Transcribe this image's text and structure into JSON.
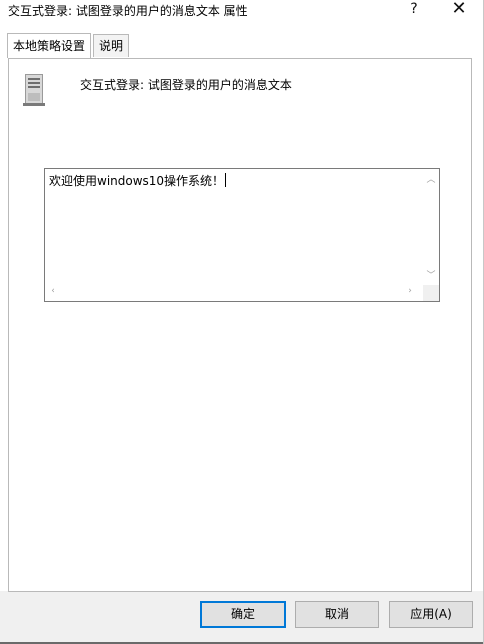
{
  "window": {
    "title": "交互式登录: 试图登录的用户的消息文本 属性",
    "help_glyph": "?",
    "close_glyph": "✕"
  },
  "tabs": [
    {
      "label": "本地策略设置",
      "active": true
    },
    {
      "label": "说明",
      "active": false
    }
  ],
  "setting": {
    "icon": "server-icon",
    "label": "交互式登录: 试图登录的用户的消息文本"
  },
  "message_box": {
    "value": "欢迎使用windows10操作系统！"
  },
  "buttons": {
    "ok": "确定",
    "cancel": "取消",
    "apply": "应用(A)"
  },
  "colors": {
    "focus_border": "#0078d7",
    "button_bg": "#e1e1e1",
    "footer_bg": "#f0f0f0"
  }
}
